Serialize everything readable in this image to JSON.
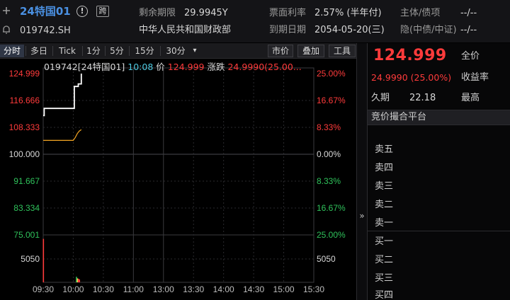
{
  "header": {
    "name": "24特国01",
    "info_glyph": "!",
    "cross_badge": "跨",
    "code": "019742.SH",
    "remaining_label": "剩余期限",
    "remaining_value": "29.9945Y",
    "issuer": "中华人民共和国财政部",
    "coupon_label": "票面利率",
    "coupon_value": "2.57% (半年付)",
    "maturity_label": "到期日期",
    "maturity_value": "2054-05-20(三)",
    "rating_label": "主体/债项",
    "rating_value": "--/--",
    "implied_label": "隐(中债/中证)",
    "implied_value": "--/--"
  },
  "toolbar": {
    "tabs": [
      "分时",
      "多日",
      "Tick",
      "1分",
      "5分",
      "15分",
      "30分"
    ],
    "more_glyph": "▾",
    "buttons": [
      "市价",
      "叠加",
      "工具"
    ]
  },
  "legend": {
    "code": "019742[24特国01]",
    "time": "10:08",
    "price_label": "价",
    "price_value": "124.999",
    "change_label": "涨跌",
    "change_value": "24.9990(25.00..."
  },
  "chart_data": {
    "type": "line",
    "price_axis": {
      "ticks": [
        "124.999",
        "116.666",
        "108.333",
        "100.000",
        "91.667",
        "83.334",
        "75.001"
      ],
      "tick_values": [
        124.999,
        116.666,
        108.333,
        100.0,
        91.667,
        83.334,
        75.001
      ],
      "ylim": [
        75.001,
        124.999
      ],
      "pct_ticks": [
        "25.00%",
        "16.67%",
        "8.33%",
        "0.00%",
        "8.33%",
        "16.67%",
        "25.00%"
      ]
    },
    "volume_axis": {
      "ticks": [
        "5050"
      ]
    },
    "x_ticks": [
      "09:30",
      "10:00",
      "10:30",
      "11:00",
      "13:00",
      "13:30",
      "14:00",
      "14:30",
      "15:00",
      "15:30"
    ],
    "price_series": {
      "x": [
        "09:30",
        "09:31",
        "09:45",
        "09:46",
        "10:00",
        "10:01",
        "10:04",
        "10:05",
        "10:07",
        "10:08"
      ],
      "y": [
        112.0,
        114.2,
        114.2,
        114.2,
        114.2,
        121.0,
        121.0,
        121.8,
        121.8,
        124.999
      ]
    },
    "avg_series": {
      "x": [
        "09:30",
        "09:45",
        "10:00",
        "10:02",
        "10:04",
        "10:06",
        "10:08"
      ],
      "y": [
        104.3,
        104.3,
        104.3,
        105.2,
        106.4,
        107.2,
        107.6
      ]
    },
    "volume_bars": [
      {
        "x": "09:30",
        "value": 5500,
        "color": "#ff3b3b"
      },
      {
        "x": "10:03",
        "value": 700,
        "color": "#2fc25b"
      },
      {
        "x": "10:04",
        "value": 500,
        "color": "#f5d24a"
      },
      {
        "x": "10:05",
        "value": 450,
        "color": "#ff3b3b"
      },
      {
        "x": "10:06",
        "value": 350,
        "color": "#ff3b3b"
      }
    ],
    "grid": true
  },
  "quote": {
    "price": "124.999",
    "full_price_label": "全价",
    "change": "24.9990 (25.00%)",
    "yield_label": "收益率",
    "duration_label": "久期",
    "duration_value": "22.18",
    "high_label": "最高",
    "platform": "竞价撮合平台",
    "asks": [
      "卖五",
      "卖四",
      "卖三",
      "卖二",
      "卖一"
    ],
    "bids": [
      "买一",
      "买二",
      "买三",
      "买四"
    ]
  },
  "colors": {
    "up": "#ff3b3b",
    "down": "#2fc25b",
    "neutral": "#d8d8d8",
    "accent": "#4a90e2",
    "avg_line": "#f5a623"
  }
}
